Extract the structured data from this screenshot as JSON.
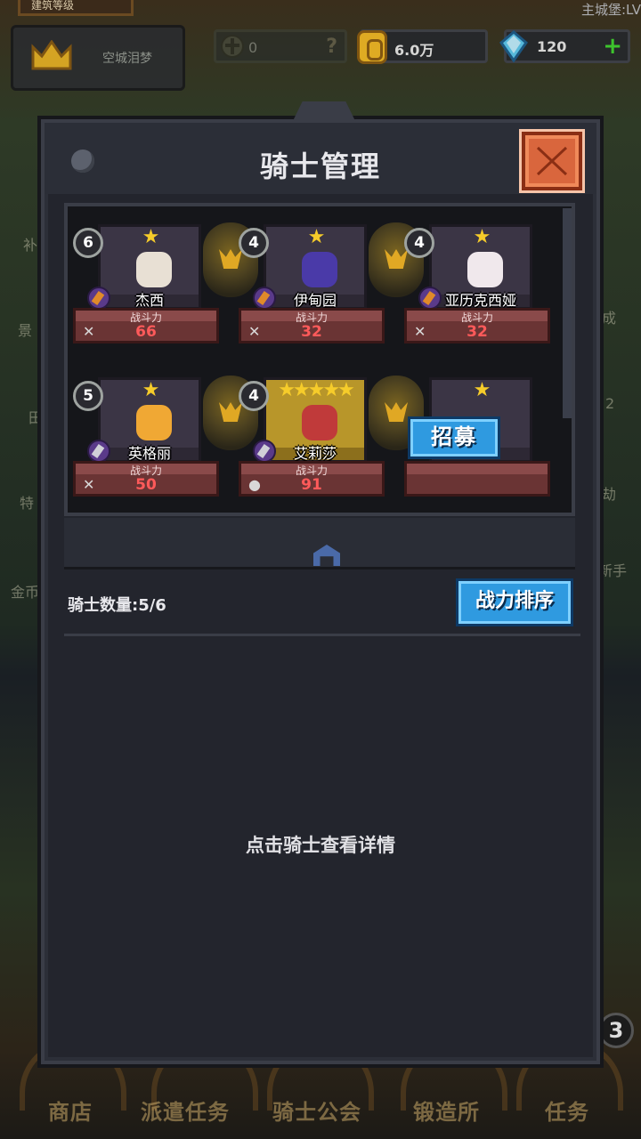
{
  "header": {
    "banner_text": "建筑等级",
    "castle_level": "主城堡:LV",
    "player_name": "空城泪梦",
    "shield_value": "0",
    "shield_hint": "?",
    "gold": "6.0万",
    "gems": "120",
    "plus": "+"
  },
  "side_labels": [
    "补",
    "景",
    "田",
    "特",
    "金币",
    "成",
    "2",
    "劫",
    "新手"
  ],
  "dialog": {
    "title": "骑士管理",
    "knights": [
      {
        "level": "6",
        "stars": "★",
        "name": "杰西",
        "stat_label": "战斗力",
        "power": "66"
      },
      {
        "level": "4",
        "stars": "★",
        "name": "伊甸园",
        "stat_label": "战斗力",
        "power": "32"
      },
      {
        "level": "4",
        "stars": "★",
        "name": "亚历克西娅",
        "stat_label": "战斗力",
        "power": "32"
      },
      {
        "level": "5",
        "stars": "★",
        "name": "英格丽",
        "stat_label": "战斗力",
        "power": "50"
      },
      {
        "level": "4",
        "stars": "★★★★★",
        "name": "艾莉莎",
        "stat_label": "战斗力",
        "power": "91"
      },
      {
        "level": "",
        "stars": "★",
        "name": "",
        "stat_label": "",
        "power": ""
      }
    ],
    "recruit_label": "招募",
    "knight_count": "骑士数量:5/6",
    "sort_label": "战力排序",
    "hint": "点击骑士查看详情"
  },
  "bottom_nav": [
    "商店",
    "派遣任务",
    "骑士公会",
    "锻造所",
    "任务"
  ],
  "badge_count": "3",
  "colors": {
    "accent_blue": "#2f9ae0",
    "close_orange": "#d9663d",
    "power_red": "#ff5a5a",
    "star_gold": "#f6cc2a"
  }
}
